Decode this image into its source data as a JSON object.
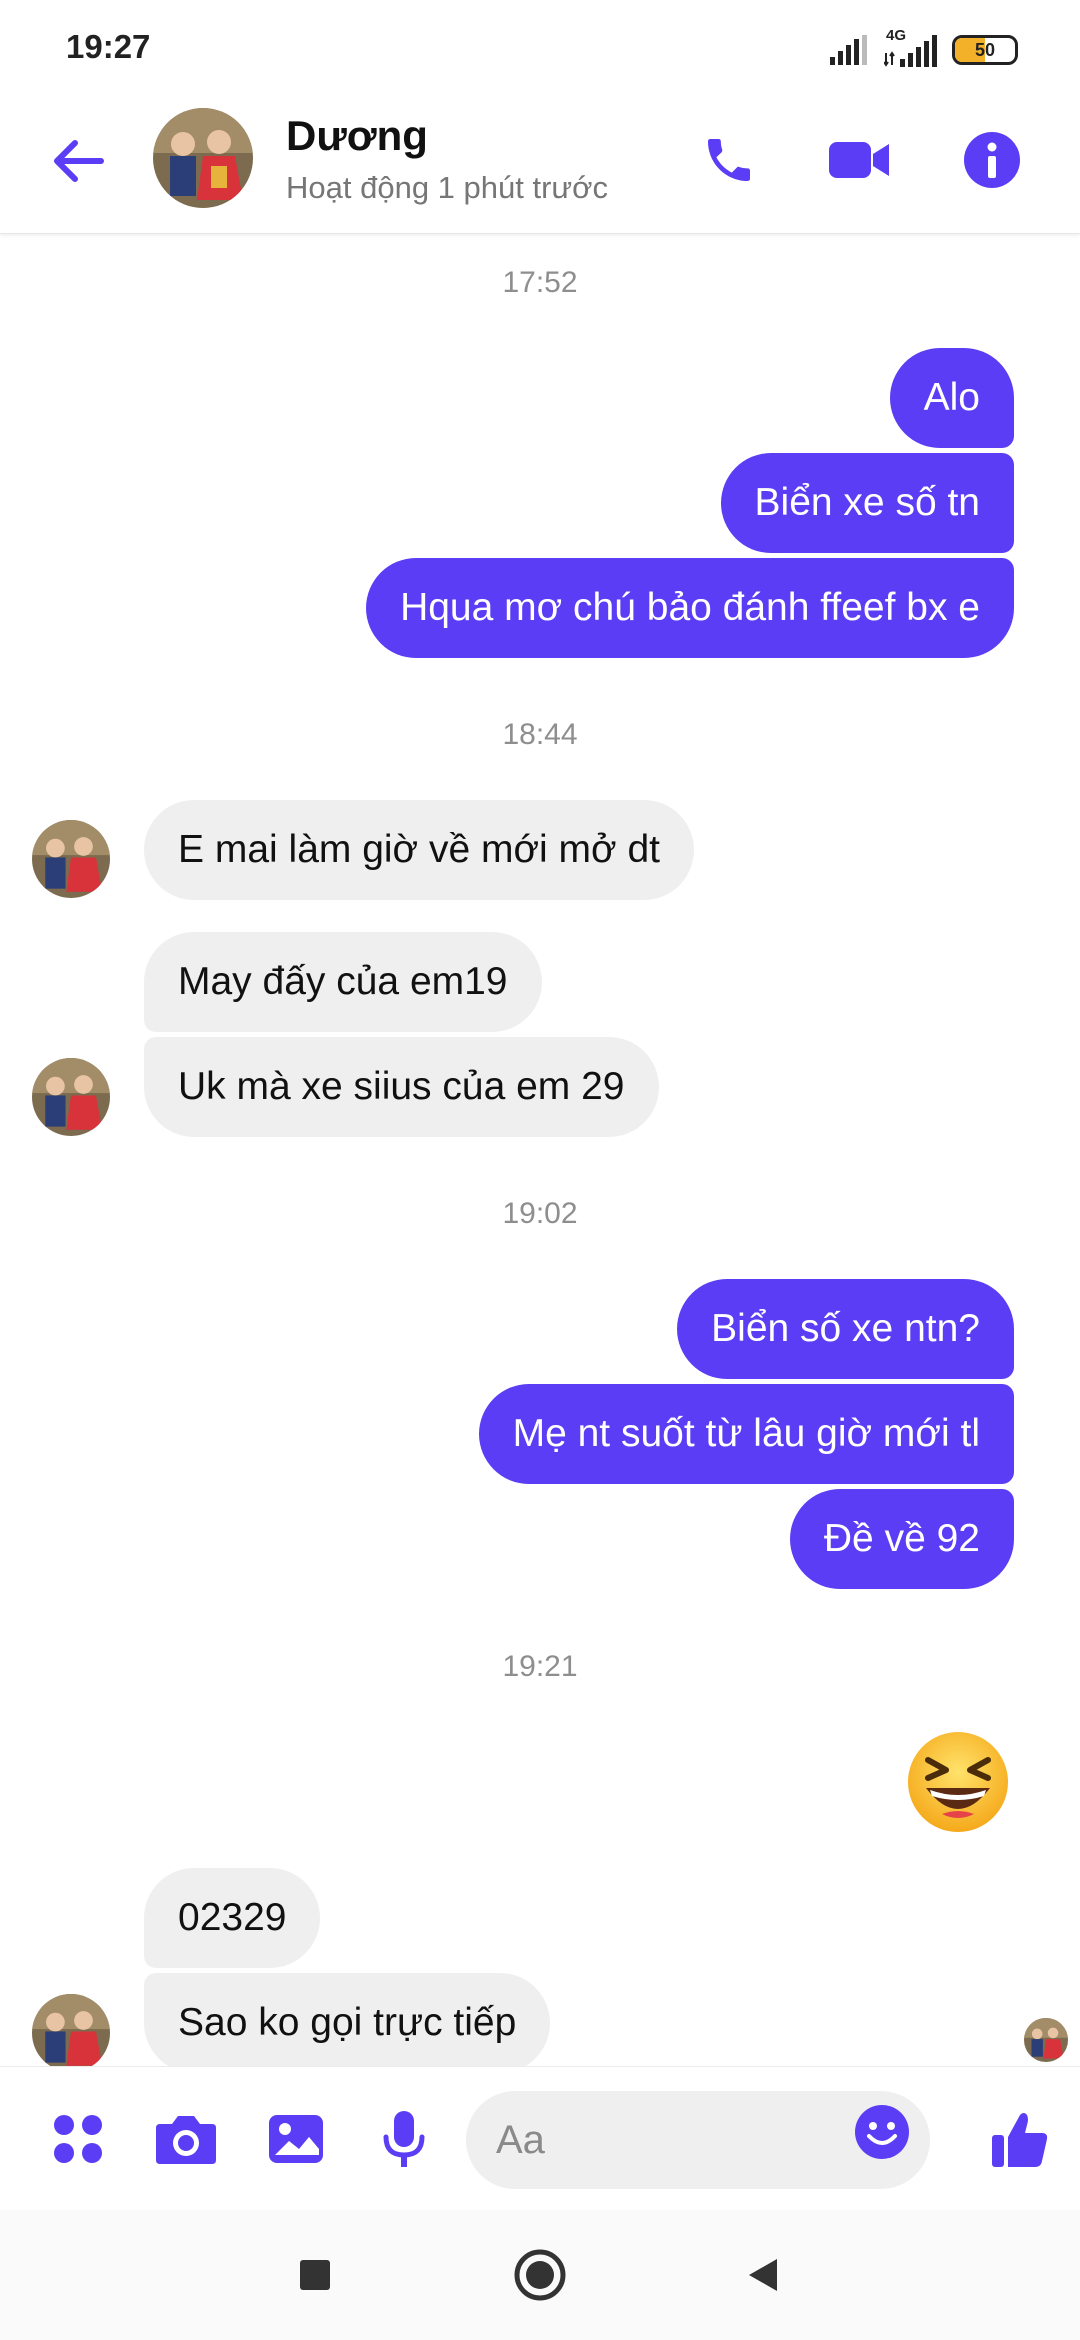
{
  "status_bar": {
    "time": "19:27",
    "network": "4G",
    "battery": "50"
  },
  "header": {
    "contact_name": "Dương",
    "contact_status": "Hoạt động 1 phút trước"
  },
  "timestamps": [
    "17:52",
    "18:44",
    "19:02",
    "19:21"
  ],
  "messages": [
    {
      "text": "Alo"
    },
    {
      "text": "Biển xe số tn"
    },
    {
      "text": "Hqua mơ chú bảo đánh ffeef bx e"
    },
    {
      "text": "E mai làm  giờ  về  mới  mở  dt"
    },
    {
      "text": "May đấy  của  em19"
    },
    {
      "text": "Uk mà  xe siius của  em 29"
    },
    {
      "text": "Biển số xe ntn?"
    },
    {
      "text": "Mẹ nt suốt từ lâu giờ mới tl"
    },
    {
      "text": "Đề về 92"
    },
    {
      "text": "02329"
    },
    {
      "text": "Sao ko gọi trực  tiếp"
    }
  ],
  "composer": {
    "placeholder": "Aa"
  },
  "colors": {
    "accent": "#5b3df5",
    "incoming_bubble": "#efefef"
  }
}
